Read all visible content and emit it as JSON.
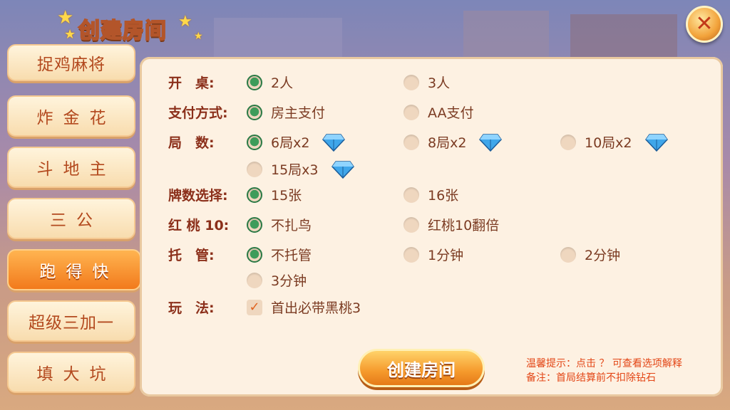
{
  "window": {
    "title": "创建房间",
    "close_icon": "close-icon"
  },
  "sidebar": {
    "items": [
      {
        "label": "捉鸡麻将",
        "active": false
      },
      {
        "label": "炸金花",
        "active": false
      },
      {
        "label": "斗地主",
        "active": false
      },
      {
        "label": "三公",
        "active": false
      },
      {
        "label": "跑得快",
        "active": true
      },
      {
        "label": "超级三加一",
        "active": false
      },
      {
        "label": "填大坑",
        "active": false
      }
    ]
  },
  "settings": {
    "rows": [
      {
        "label": "开　桌:",
        "options": [
          {
            "text": "2人",
            "selected": true
          },
          {
            "text": "3人",
            "selected": false
          }
        ]
      },
      {
        "label": "支付方式:",
        "options": [
          {
            "text": "房主支付",
            "selected": true
          },
          {
            "text": "AA支付",
            "selected": false
          }
        ]
      },
      {
        "label": "局　数:",
        "options": [
          {
            "text": "6局x2",
            "selected": true,
            "icon": "diamond-icon"
          },
          {
            "text": "8局x2",
            "selected": false,
            "icon": "diamond-icon"
          },
          {
            "text": "10局x2",
            "selected": false,
            "icon": "diamond-icon"
          },
          {
            "text": "15局x3",
            "selected": false,
            "icon": "diamond-icon"
          }
        ]
      },
      {
        "label": "牌数选择:",
        "options": [
          {
            "text": "15张",
            "selected": true
          },
          {
            "text": "16张",
            "selected": false
          }
        ]
      },
      {
        "label": "红 桃 10:",
        "options": [
          {
            "text": "不扎鸟",
            "selected": true
          },
          {
            "text": "红桃10翻倍",
            "selected": false
          }
        ]
      },
      {
        "label": "托　管:",
        "options": [
          {
            "text": "不托管",
            "selected": true
          },
          {
            "text": "1分钟",
            "selected": false
          },
          {
            "text": "2分钟",
            "selected": false
          },
          {
            "text": "3分钟",
            "selected": false
          }
        ]
      },
      {
        "label": "玩　法:",
        "options": [
          {
            "text": "首出必带黑桃3",
            "checked": true
          }
        ]
      }
    ]
  },
  "footer": {
    "create_label": "创建房间",
    "tip1": "温馨提示：点击 ？ 可查看选项解释",
    "tip2": "备注：首局结算前不扣除钻石"
  },
  "colors": {
    "accent": "#f27a1c",
    "label": "#8b2f1a",
    "selected_radio": "#3e9c5a",
    "tip": "#e34616"
  }
}
